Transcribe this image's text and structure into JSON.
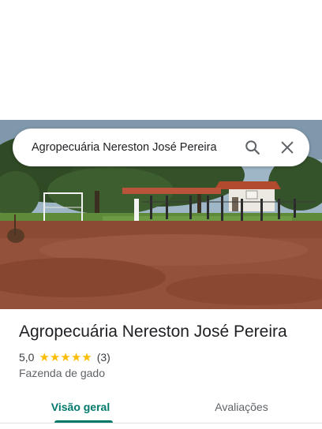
{
  "search": {
    "query": "Agropecuária Nereston José Pereira"
  },
  "place": {
    "name": "Agropecuária Nereston José Pereira",
    "rating": "5,0",
    "stars": 5,
    "review_count": "(3)",
    "category": "Fazenda de gado"
  },
  "tabs": [
    {
      "label": "Visão geral",
      "active": true
    },
    {
      "label": "Avaliações",
      "active": false
    }
  ],
  "colors": {
    "accent": "#00796b",
    "star": "#fbbc04",
    "text_primary": "#202124",
    "text_secondary": "#5f6368"
  },
  "icons": {
    "search": "search-icon",
    "close": "close-icon",
    "star": "star-icon"
  }
}
